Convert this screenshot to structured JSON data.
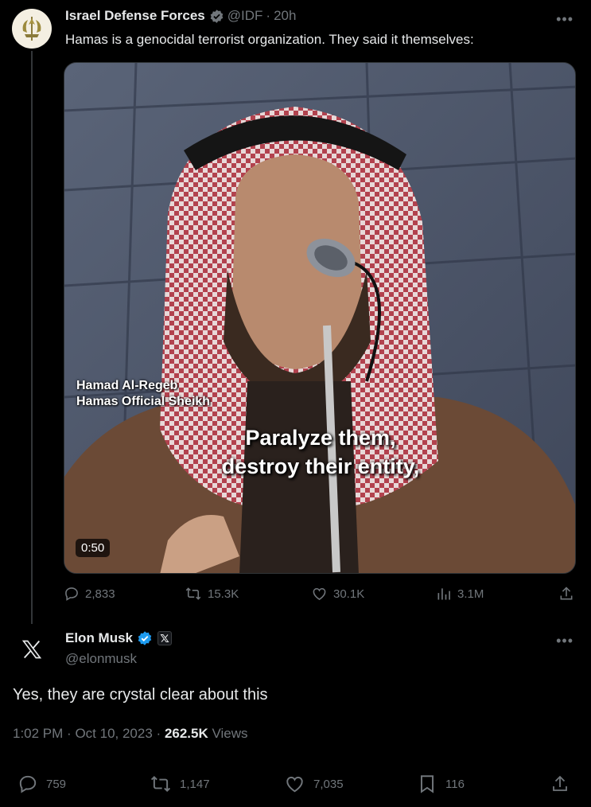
{
  "parent_tweet": {
    "author_name": "Israel Defense Forces",
    "handle": "@IDF",
    "separator": "·",
    "time": "20h",
    "text": "Hamas is a genocidal terrorist organization. They said it themselves:",
    "media": {
      "caption_name": "Hamad Al-Regeb",
      "caption_title": "Hamas Official Sheikh",
      "subtitle_line1": "Paralyze them,",
      "subtitle_line2": "destroy their entity,",
      "duration": "0:50"
    },
    "stats": {
      "replies": "2,833",
      "reposts": "15.3K",
      "likes": "30.1K",
      "views": "3.1M"
    },
    "colors": {
      "verified": "#1d9bf0",
      "avatar_bg": "#f4efe2"
    }
  },
  "main_tweet": {
    "author_name": "Elon Musk",
    "handle": "@elonmusk",
    "affiliate_badge_icon": "x-logo-icon",
    "text": "Yes, they are crystal clear about this",
    "time": "1:02 PM",
    "date": "Oct 10, 2023",
    "separator": "·",
    "views_count": "262.5K",
    "views_label": "Views",
    "stats": {
      "replies": "759",
      "reposts": "1,147",
      "likes": "7,035",
      "bookmarks": "116"
    }
  },
  "icons": [
    "more-icon",
    "verified-badge-icon",
    "reply-icon",
    "repost-icon",
    "like-icon",
    "views-icon",
    "share-icon",
    "bookmark-icon",
    "x-logo-icon",
    "idf-emblem-icon"
  ]
}
